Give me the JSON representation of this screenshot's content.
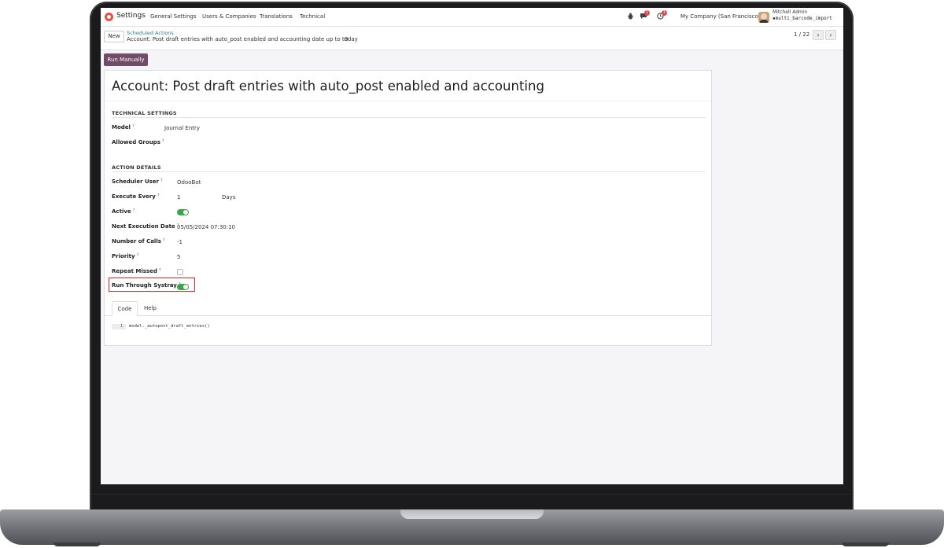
{
  "navbar": {
    "app_name": "Settings",
    "menu": [
      "General Settings",
      "Users & Companies",
      "Translations",
      "Technical"
    ],
    "icons": [
      "bug-icon",
      "chat-icon",
      "clock-icon"
    ],
    "badges": [
      "1",
      "1"
    ],
    "company": "My Company (San Francisco)",
    "user_name": "Mitchell Admin",
    "database": "multi_barcode_import"
  },
  "control_panel": {
    "new_label": "New",
    "breadcrumb_parent": "Scheduled Actions",
    "breadcrumb_current": "Account: Post draft entries with auto_post enabled and accounting date up to today",
    "gear_icon": "⚙",
    "pager_value": "1 / 22",
    "prev_glyph": "‹",
    "next_glyph": "›"
  },
  "actions": {
    "run_manually_label": "Run Manually"
  },
  "form": {
    "title": "Account: Post draft entries with auto_post enabled and accounting date up to today",
    "help_marker": "?",
    "technical": {
      "heading": "TECHNICAL SETTINGS",
      "model_label": "Model",
      "model_value": "Journal Entry",
      "groups_label": "Allowed Groups"
    },
    "action_details": {
      "heading": "ACTION DETAILS",
      "scheduler_label": "Scheduler User",
      "scheduler_value": "OdooBot",
      "execute_label": "Execute Every",
      "execute_value": "1",
      "execute_unit": "Days",
      "active_label": "Active",
      "active": true,
      "next_exec_label": "Next Execution Date",
      "next_exec_value": "05/05/2024 07:30:10",
      "calls_label": "Number of Calls",
      "calls_value": "-1",
      "priority_label": "Priority",
      "priority_value": "5",
      "repeat_label": "Repeat Missed",
      "repeat_missed": false,
      "systray_label": "Run Through Systray",
      "systray": true
    },
    "tabs": [
      "Code",
      "Help"
    ],
    "code": {
      "line_number": "1",
      "content": "model._autopost_draft_entries()"
    }
  },
  "colors": {
    "primary": "#714b67",
    "toggle_on": "#3aa64a",
    "highlight": "#d4242b",
    "link": "#2a7d8b"
  }
}
